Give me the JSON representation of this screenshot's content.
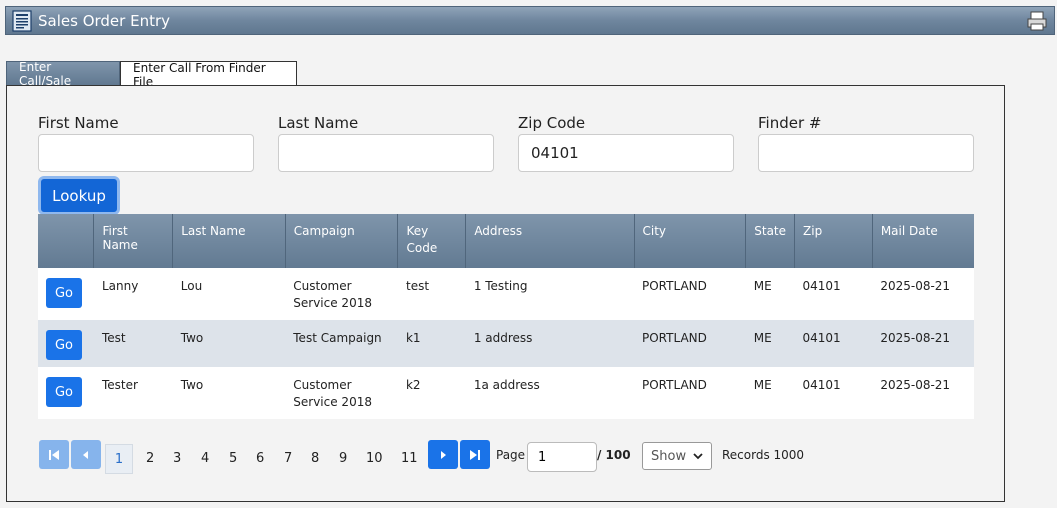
{
  "window": {
    "title": "Sales Order Entry"
  },
  "tabs": [
    {
      "label": "Enter Call/Sale",
      "active": false
    },
    {
      "label": "Enter Call From Finder File",
      "active": true
    }
  ],
  "search": {
    "first_name": {
      "label": "First Name",
      "value": ""
    },
    "last_name": {
      "label": "Last Name",
      "value": ""
    },
    "zip_code": {
      "label": "Zip Code",
      "value": "04101"
    },
    "finder": {
      "label": "Finder #",
      "value": ""
    },
    "lookup_label": "Lookup"
  },
  "table": {
    "columns": [
      "",
      "First Name",
      "Last Name",
      "Campaign",
      "Key Code",
      "Address",
      "City",
      "State",
      "Zip",
      "Mail Date"
    ],
    "go_label": "Go",
    "rows": [
      {
        "first": "Lanny",
        "last": "Lou",
        "campaign": "Customer Service 2018",
        "key": "test",
        "address": "1 Testing",
        "city": "PORTLAND",
        "state": "ME",
        "zip": "04101",
        "date": "2025-08-21"
      },
      {
        "first": "Test",
        "last": "Two",
        "campaign": "Test Campaign",
        "key": "k1",
        "address": "1 address",
        "city": "PORTLAND",
        "state": "ME",
        "zip": "04101",
        "date": "2025-08-21"
      },
      {
        "first": "Tester",
        "last": "Two",
        "campaign": "Customer Service 2018",
        "key": "k2",
        "address": "1a address",
        "city": "PORTLAND",
        "state": "ME",
        "zip": "04101",
        "date": "2025-08-21"
      }
    ]
  },
  "pager": {
    "pages": [
      "1",
      "2",
      "3",
      "4",
      "5",
      "6",
      "7",
      "8",
      "9",
      "10",
      "11"
    ],
    "current": "1",
    "page_label": "Page",
    "page_value": "1",
    "total": "/ 100",
    "show_label": "Show",
    "records": "Records 1000"
  },
  "colors": {
    "header": "#6f869e",
    "button": "#1a73e8",
    "row_alt": "#dde3ea"
  }
}
